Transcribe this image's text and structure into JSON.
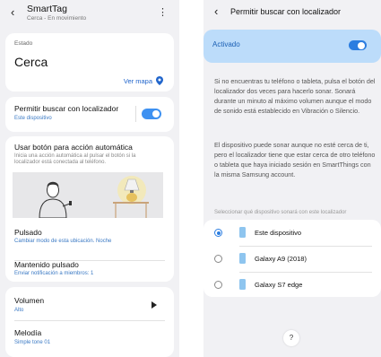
{
  "left": {
    "header": {
      "back_icon": "‹",
      "title": "SmartTag",
      "subtitle": "Cerca - En movimiento",
      "menu_icon": "⋮"
    },
    "status": {
      "label": "Estado",
      "value": "Cerca",
      "map_link": "Ver mapa"
    },
    "locator": {
      "title": "Permitir buscar con localizador",
      "sub": "Este dispositivo",
      "toggle_on": true
    },
    "auto_action": {
      "title": "Usar botón para acción automática",
      "desc": "Inicia una acción automática al pulsar el botón si la localizador está conectada al teléfono."
    },
    "pressed": {
      "title": "Pulsado",
      "sub": "Cambiar modo de esta ubicación. Noche"
    },
    "held": {
      "title": "Mantenido pulsado",
      "sub": "Enviar notificación a miembros: 1"
    },
    "volume": {
      "title": "Volumen",
      "sub": "Alto"
    },
    "melody": {
      "title": "Melodía",
      "sub": "Simple tone 01"
    }
  },
  "right": {
    "header": {
      "back_icon": "‹",
      "title": "Permitir buscar con localizador"
    },
    "activated_label": "Activado",
    "toggle_on": true,
    "para1": "Si no encuentras tu teléfono o tableta, pulsa el botón del localizador dos veces para hacerlo sonar. Sonará durante un minuto al máximo volumen aunque el modo de sonido está establecido en Vibración o Silencio.",
    "para2": "El dispositivo puede sonar aunque no esté cerca de ti, pero el localizador tiene que estar cerca de otro teléfono o tableta que haya iniciado sesión en SmartThings con la misma Samsung account.",
    "select_label": "Seleccionar qué dispositivo sonará con este localizador",
    "devices": [
      {
        "name": "Este dispositivo",
        "selected": true
      },
      {
        "name": "Galaxy A9 (2018)",
        "selected": false
      },
      {
        "name": "Galaxy S7 edge",
        "selected": false
      }
    ],
    "help": "?"
  },
  "colors": {
    "accent": "#3e91f1",
    "link": "#2266cc",
    "activated_bg": "#bcdcfa",
    "sub_text": "#3a79c4"
  }
}
